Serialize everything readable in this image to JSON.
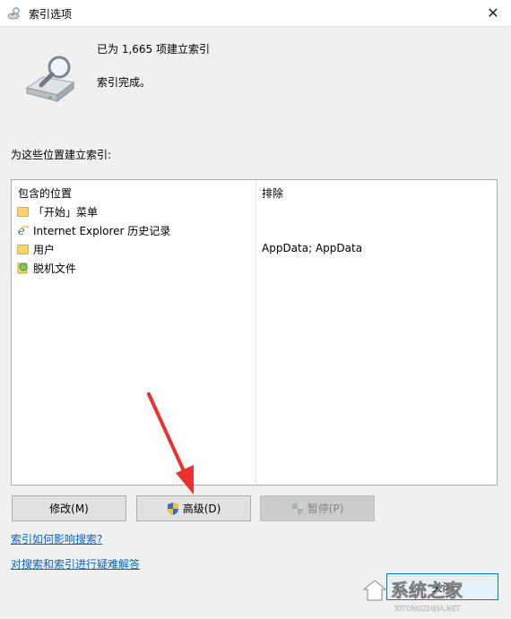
{
  "window": {
    "title": "索引选项",
    "close_glyph": "✕"
  },
  "status": {
    "line1": "已为 1,665 项建立索引",
    "line2": "索引完成。"
  },
  "locations": {
    "section_label": "为这些位置建立索引:",
    "col_included": "包含的位置",
    "col_excluded": "排除",
    "rows": [
      {
        "icon": "folder-icon",
        "name": "「开始」菜单",
        "excluded": ""
      },
      {
        "icon": "ie-icon",
        "name": "Internet Explorer 历史记录",
        "excluded": ""
      },
      {
        "icon": "folder-icon",
        "name": "用户",
        "excluded": "AppData; AppData"
      },
      {
        "icon": "offline-files-icon",
        "name": "脱机文件",
        "excluded": ""
      }
    ]
  },
  "buttons": {
    "modify": "修改(M)",
    "advanced": "高级(D)",
    "pause": "暂停(P)"
  },
  "links": {
    "how_affects": "索引如何影响搜索?",
    "troubleshoot": "对搜索和索引进行疑难解答"
  },
  "close_button": "关闭",
  "watermark": {
    "text": "系统之家",
    "sub": "XITONGZHIJIA.NET"
  },
  "colors": {
    "link": "#0066cc",
    "arrow": "#e8322f",
    "shield_blue": "#2d6fc4",
    "shield_yellow": "#f2c12e"
  }
}
